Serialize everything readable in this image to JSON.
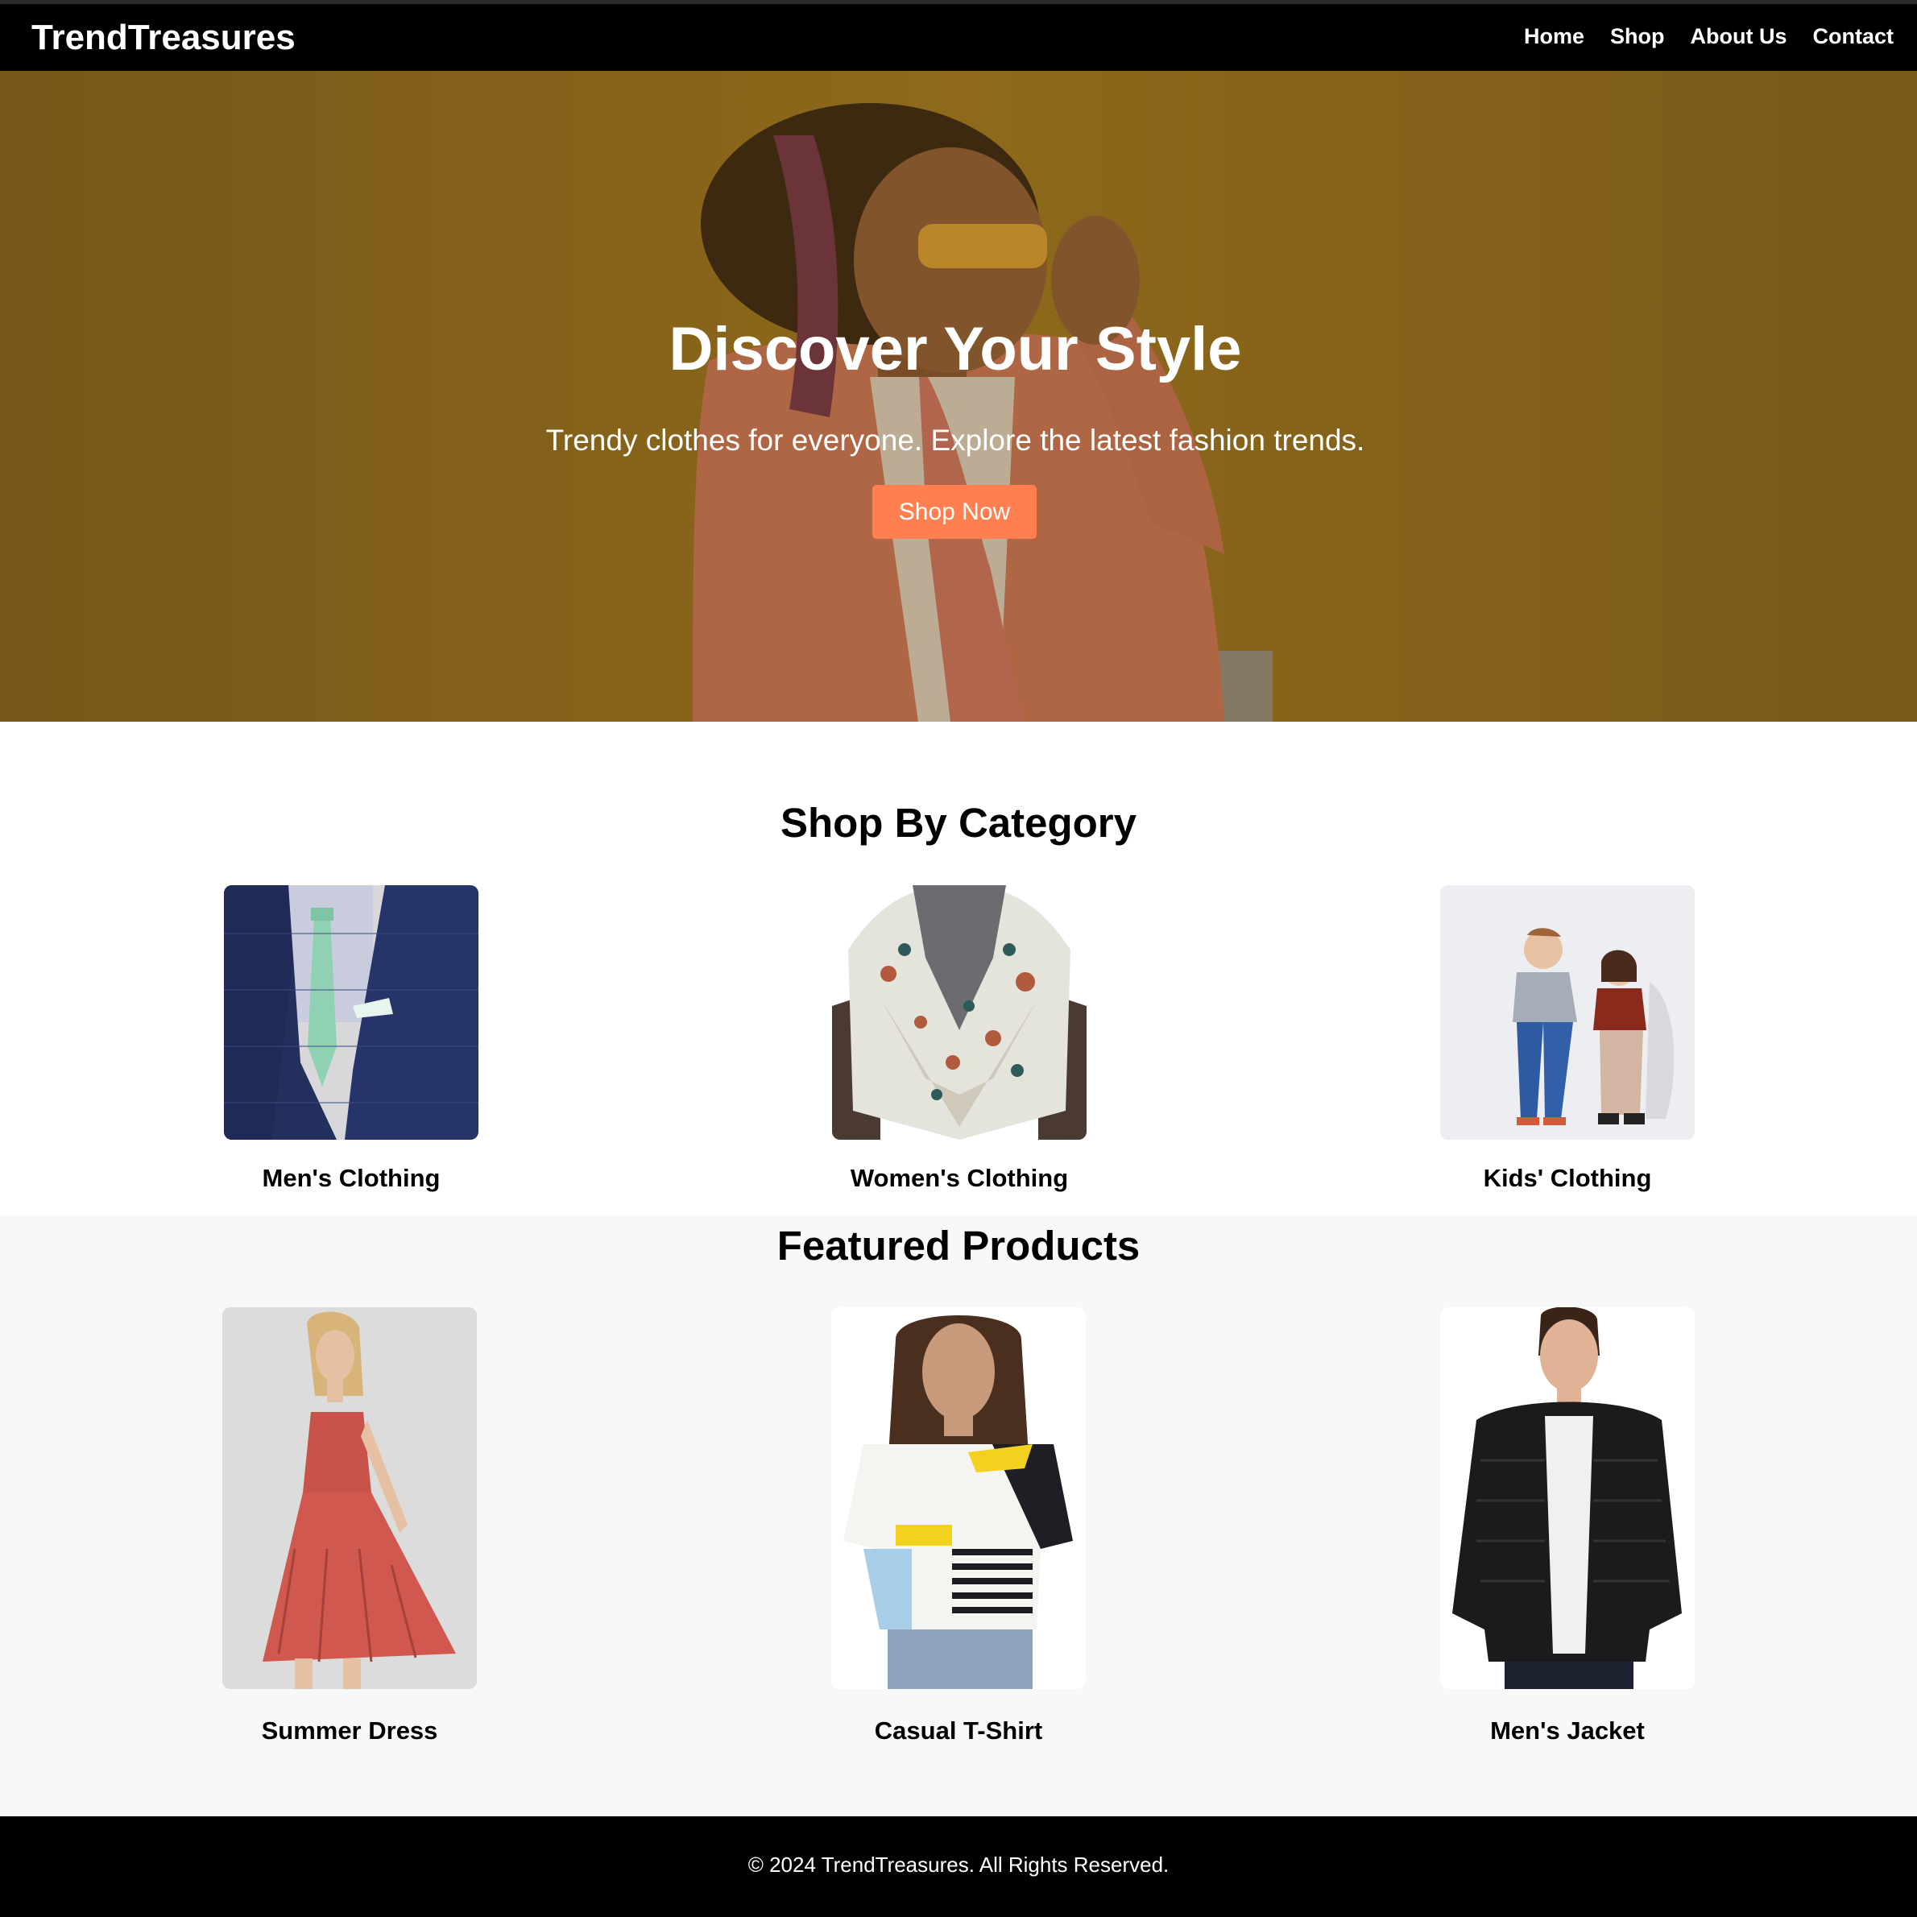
{
  "brand": {
    "name": "TrendTreasures"
  },
  "nav": {
    "items": [
      "Home",
      "Shop",
      "About Us",
      "Contact"
    ]
  },
  "hero": {
    "title": "Discover Your Style",
    "subtitle": "Trendy clothes for everyone. Explore the latest fashion trends.",
    "cta_label": "Shop Now",
    "cta_color": "#ff7f50",
    "overlay_color": "#7d5f22"
  },
  "categories": {
    "title": "Shop By Category",
    "items": [
      {
        "label": "Men's Clothing",
        "image": "navy plaid blazer with mint tie"
      },
      {
        "label": "Women's Clothing",
        "image": "floral silk scarf on mannequin"
      },
      {
        "label": "Kids' Clothing",
        "image": "two kids posing in jeans and sweaters"
      }
    ]
  },
  "featured": {
    "title": "Featured Products",
    "items": [
      {
        "label": "Summer Dress",
        "image": "woman in red halter sundress"
      },
      {
        "label": "Casual T-Shirt",
        "image": "woman in graphic print t-shirt"
      },
      {
        "label": "Men's Jacket",
        "image": "man in black puffer jacket"
      }
    ]
  },
  "footer": {
    "text": "© 2024 TrendTreasures. All Rights Reserved."
  }
}
